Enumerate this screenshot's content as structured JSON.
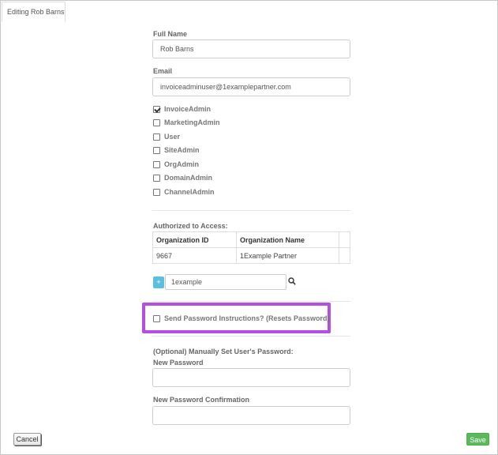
{
  "tab": {
    "title": "Editing Rob Barns"
  },
  "form": {
    "full_name_label": "Full Name",
    "full_name_value": "Rob Barns",
    "email_label": "Email",
    "email_value": "invoiceadminuser@1examplepartner.com",
    "roles": [
      {
        "label": "InvoiceAdmin",
        "checked": true
      },
      {
        "label": "MarketingAdmin",
        "checked": false
      },
      {
        "label": "User",
        "checked": false
      },
      {
        "label": "SiteAdmin",
        "checked": false
      },
      {
        "label": "OrgAdmin",
        "checked": false
      },
      {
        "label": "DomainAdmin",
        "checked": false
      },
      {
        "label": "ChannelAdmin",
        "checked": false
      }
    ],
    "access_label": "Authorized to Access:",
    "access_table": {
      "headers": [
        "Organization ID",
        "Organization Name"
      ],
      "rows": [
        [
          "9667",
          "1Example Partner"
        ]
      ]
    },
    "add_button": "+",
    "org_search_value": "1example",
    "send_password_label": "Send Password Instructions? (Resets Password)",
    "send_password_checked": false,
    "manual_password_heading": "(Optional) Manually Set User's Password:",
    "new_password_label": "New Password",
    "new_password_confirm_label": "New Password Confirmation"
  },
  "footer": {
    "cancel_label": "Cancel",
    "save_label": "Save"
  },
  "colors": {
    "save": "#5cb85c",
    "add": "#5bc0de",
    "highlight": "#b44fe0"
  }
}
